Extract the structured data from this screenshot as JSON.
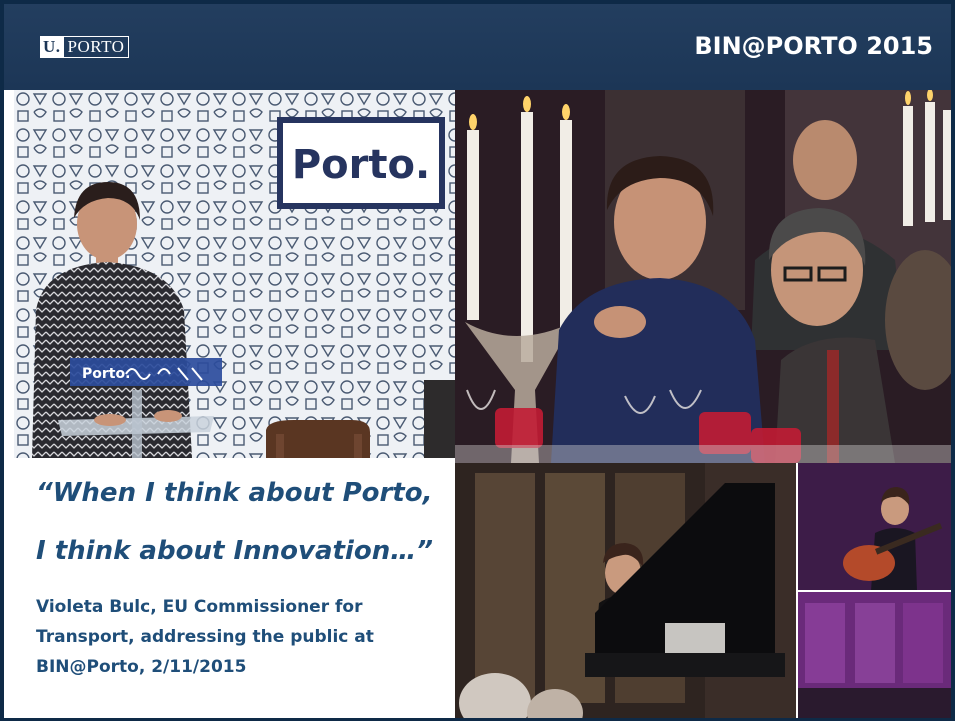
{
  "header": {
    "logo_u": "U.",
    "logo_rest": "PORTO",
    "event_title": "BIN@PORTO 2015"
  },
  "photos": {
    "speaker_sign": "Porto.",
    "podium_sign": "Porto."
  },
  "quote": {
    "line1": "“When I think about Porto,",
    "line2": "I think about Innovation…”"
  },
  "attribution": {
    "line1": "Violeta Bulc, EU Commissioner for",
    "line2": "Transport, addressing the public at",
    "line3": "BIN@Porto, 2/11/2015"
  },
  "colors": {
    "header_bg": "#1c3656",
    "quote_text": "#1f4e79",
    "border": "#0e2a47"
  }
}
